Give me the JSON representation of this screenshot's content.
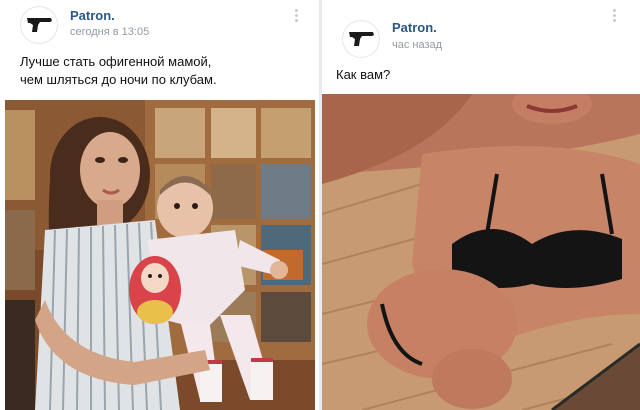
{
  "left_post": {
    "author": "Patron.",
    "time": "сегодня в 13:05",
    "text_line1": "Лучше стать офигенной мамой,",
    "text_line2": "чем шляться до ночи по клубам.",
    "avatar_icon": "pistol-icon",
    "more_icon": "more-vertical-icon"
  },
  "right_post": {
    "author": "Patron.",
    "time": "час назад",
    "text": "Как вам?",
    "avatar_icon": "pistol-icon",
    "more_icon": "more-vertical-icon"
  },
  "colors": {
    "author": "#2a5885",
    "meta": "#939aa2",
    "text": "#111111",
    "background": "#ffffff"
  }
}
